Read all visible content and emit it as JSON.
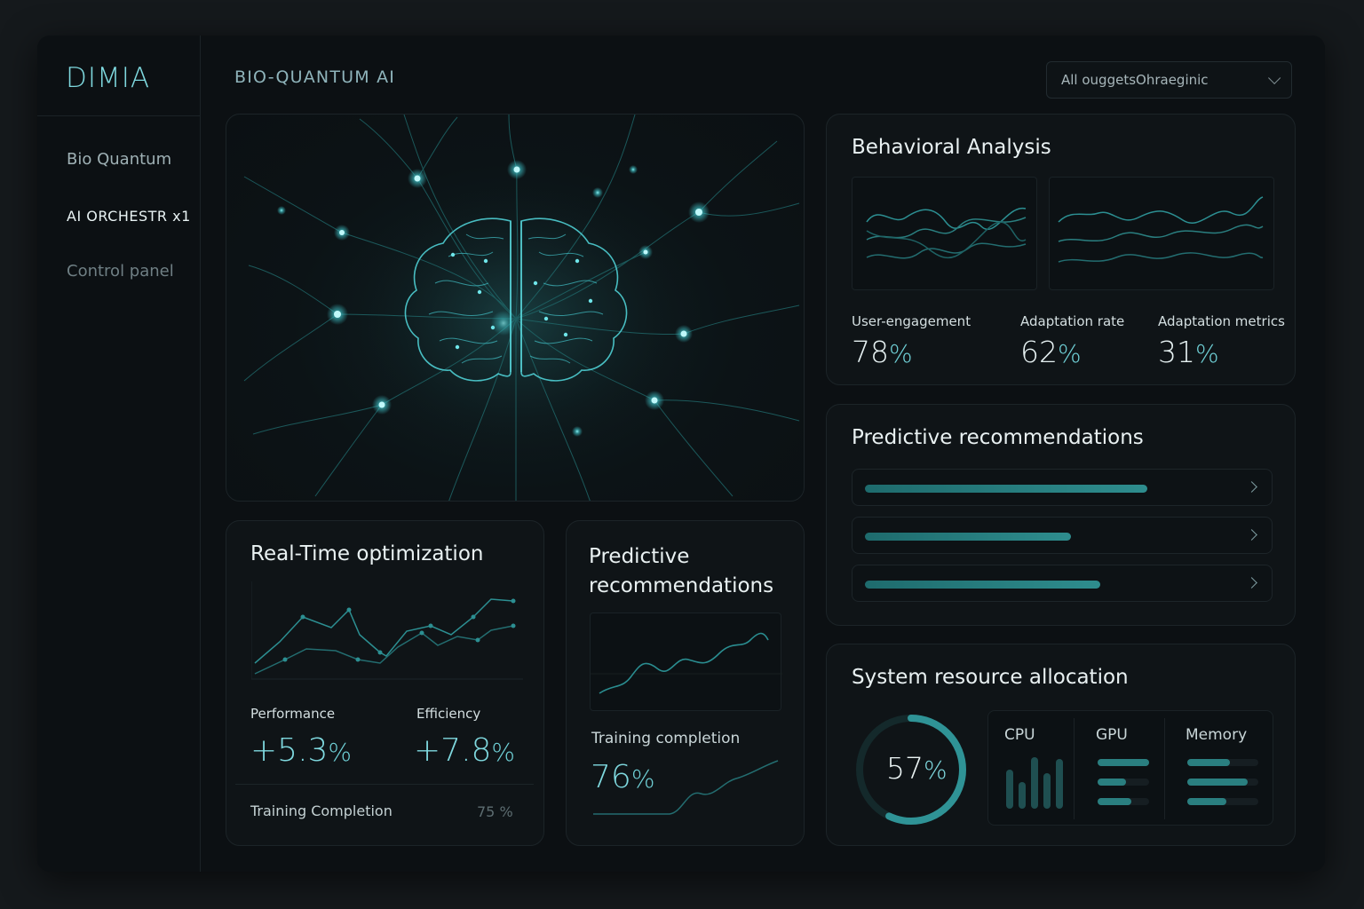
{
  "brand": "DIMIA",
  "sidebar": {
    "items": [
      {
        "label": "Bio Quantum"
      },
      {
        "label": "AI ORCHESTR x1"
      },
      {
        "label": "Control panel"
      }
    ]
  },
  "header": {
    "title": "BIO-QUANTUM AI",
    "select_value": "All ouggetsOhraeginic"
  },
  "behavioral": {
    "title": "Behavioral Analysis",
    "metrics": [
      {
        "label": "User-engagement",
        "value": "78",
        "unit": "%"
      },
      {
        "label": "Adaptation rate",
        "value": "62",
        "unit": "%"
      },
      {
        "label": "Adaptation metrics",
        "value": "31",
        "unit": "%"
      }
    ]
  },
  "predictive": {
    "title": "Predictive recommendations",
    "items": [
      {
        "progress": 0.67
      },
      {
        "progress": 0.49
      },
      {
        "progress": 0.56
      }
    ]
  },
  "realtime": {
    "title": "Real-Time optimization",
    "metrics": [
      {
        "label": "Performance",
        "value": "+5.3",
        "unit": "%"
      },
      {
        "label": "Efficiency",
        "value": "+7.8",
        "unit": "%"
      }
    ],
    "footer_label": "Training Completion",
    "footer_value": "75 %"
  },
  "predictive_small": {
    "title_line1": "Predictive",
    "title_line2": "recommendations",
    "training_label": "Training completion",
    "training_value": "76",
    "training_unit": "%"
  },
  "resources": {
    "title": "System resource allocation",
    "gauge_value": "57",
    "gauge_unit": "%",
    "gauge_fraction": 0.57,
    "columns": [
      {
        "label": "CPU"
      },
      {
        "label": "GPU",
        "bars": [
          1.0,
          0.55,
          0.65
        ]
      },
      {
        "label": "Memory",
        "bars": [
          0.6,
          0.85,
          0.55
        ]
      }
    ]
  },
  "colors": {
    "accent": "#7fd9df",
    "teal": "#2a7f80",
    "background": "#0c1013"
  }
}
